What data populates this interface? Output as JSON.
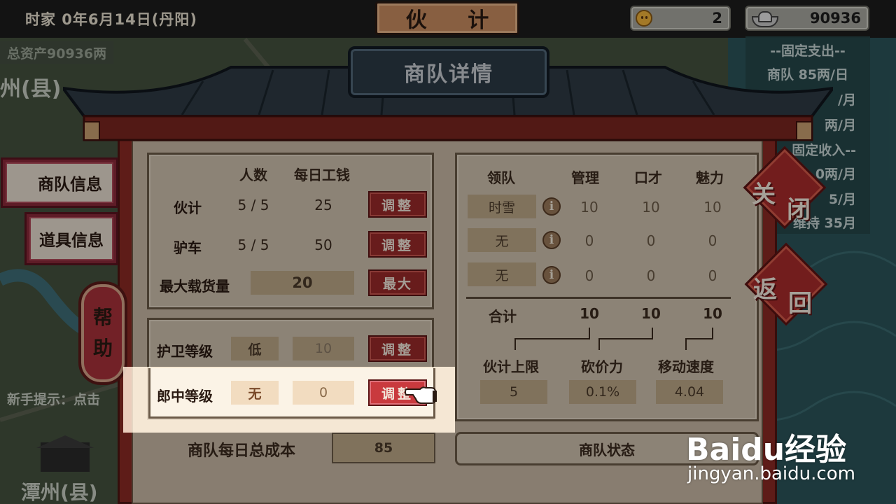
{
  "topbar": {
    "date": "时家 0年6月14日(丹阳)",
    "title": "伙 计",
    "reputation": "2",
    "money": "90936"
  },
  "map": {
    "total_assets": "总资产90936两",
    "city_top": "州(县)",
    "city_bottom": "潭州(县)",
    "tip": "新手提示：点击"
  },
  "expense": {
    "fixed_expense_title": "--固定支出--",
    "caravan_daily": "商队  85两/日",
    "line2": "/月",
    "line3": "两/月",
    "fixed_income_title": "固定收入--",
    "line5": "0两/月",
    "line6": "5/月",
    "line7": "维持 35月"
  },
  "modal": {
    "title": "商队详情",
    "tabs": [
      {
        "label": "商队信息"
      },
      {
        "label": "道具信息"
      }
    ],
    "help": [
      "帮",
      "助"
    ],
    "close": [
      "关",
      "闭"
    ],
    "back": [
      "返",
      "回"
    ],
    "staff": {
      "headers": {
        "count": "人数",
        "wage": "每日工钱"
      },
      "rows": [
        {
          "label": "伙计",
          "count": "5 / 5",
          "wage": "25",
          "button": "调整"
        },
        {
          "label": "驴车",
          "count": "5 / 5",
          "wage": "50",
          "button": "调整"
        }
      ],
      "max_load_label": "最大载货量",
      "max_load_value": "20",
      "max_button": "最大"
    },
    "levels": {
      "guard_label": "护卫等级",
      "guard_level": "低",
      "guard_value": "10",
      "guard_button": "调整",
      "doctor_label": "郎中等级",
      "doctor_level": "无",
      "doctor_value": "0",
      "doctor_button": "调整"
    },
    "daily_cost_label": "商队每日总成本",
    "daily_cost_value": "85",
    "leaders": {
      "headers": {
        "leader": "领队",
        "manage": "管理",
        "speech": "口才",
        "charm": "魅力"
      },
      "rows": [
        {
          "name": "时雪",
          "manage": "10",
          "speech": "10",
          "charm": "10"
        },
        {
          "name": "无",
          "manage": "0",
          "speech": "0",
          "charm": "0"
        },
        {
          "name": "无",
          "manage": "0",
          "speech": "0",
          "charm": "0"
        }
      ],
      "total_label": "合计",
      "total_manage": "10",
      "total_speech": "10",
      "total_charm": "10"
    },
    "derived": {
      "staff_limit_label": "伙计上限",
      "bargain_label": "砍价力",
      "speed_label": "移动速度",
      "staff_limit": "5",
      "bargain": "0.1%",
      "speed": "4.04"
    },
    "status_label": "商队状态"
  },
  "watermark": {
    "brand": "Baidu经验",
    "url": "jingyan.baidu.com"
  }
}
